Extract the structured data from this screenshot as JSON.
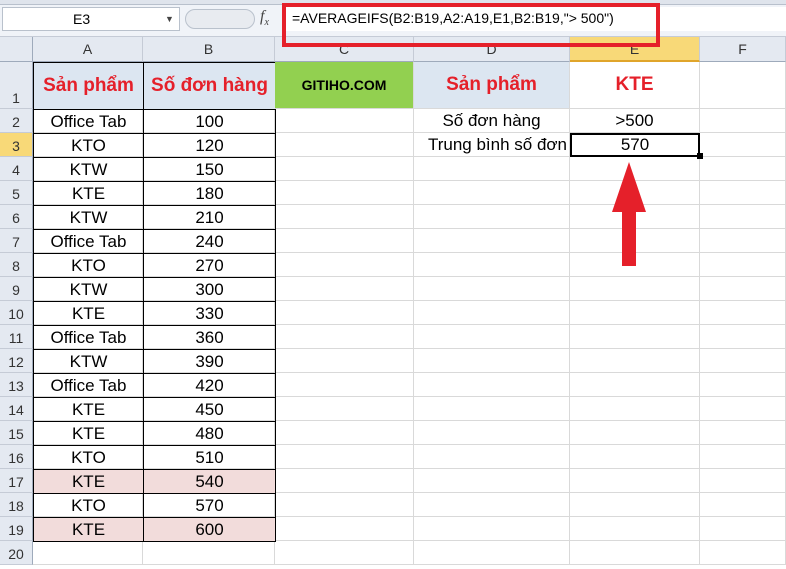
{
  "formula_bar": {
    "name_box": "E3",
    "fx_label": "fx",
    "formula": "=AVERAGEIFS(B2:B19,A2:A19,E1,B2:B19,\"> 500\")"
  },
  "columns": [
    "A",
    "B",
    "C",
    "D",
    "E",
    "F"
  ],
  "rows": [
    "1",
    "2",
    "3",
    "4",
    "5",
    "6",
    "7",
    "8",
    "9",
    "10",
    "11",
    "12",
    "13",
    "14",
    "15",
    "16",
    "17",
    "18",
    "19",
    "20"
  ],
  "selected_cell": "E3",
  "colors": {
    "highlight_pink": "#f2dcdb",
    "header_blue": "#dce6f1",
    "brand_green": "#92d050",
    "accent_red": "#e5202a"
  },
  "headers": {
    "a1": "Sản phẩm",
    "b1": "Số đơn hàng",
    "c1": "GITIHO.COM",
    "d1": "Sản phẩm",
    "e1": "KTE"
  },
  "criteria": {
    "d2": "Số đơn hàng",
    "e2": ">500",
    "d3": "Trung bình số đơn",
    "e3": "570"
  },
  "data": [
    {
      "product": "Office Tab",
      "orders": "100"
    },
    {
      "product": "KTO",
      "orders": "120"
    },
    {
      "product": "KTW",
      "orders": "150"
    },
    {
      "product": "KTE",
      "orders": "180"
    },
    {
      "product": "KTW",
      "orders": "210"
    },
    {
      "product": "Office Tab",
      "orders": "240"
    },
    {
      "product": "KTO",
      "orders": "270"
    },
    {
      "product": "KTW",
      "orders": "300"
    },
    {
      "product": "KTE",
      "orders": "330"
    },
    {
      "product": "Office Tab",
      "orders": "360"
    },
    {
      "product": "KTW",
      "orders": "390"
    },
    {
      "product": "Office Tab",
      "orders": "420"
    },
    {
      "product": "KTE",
      "orders": "450"
    },
    {
      "product": "KTE",
      "orders": "480"
    },
    {
      "product": "KTO",
      "orders": "510"
    },
    {
      "product": "KTE",
      "orders": "540",
      "highlight": true
    },
    {
      "product": "KTO",
      "orders": "570"
    },
    {
      "product": "KTE",
      "orders": "600",
      "highlight": true
    }
  ]
}
